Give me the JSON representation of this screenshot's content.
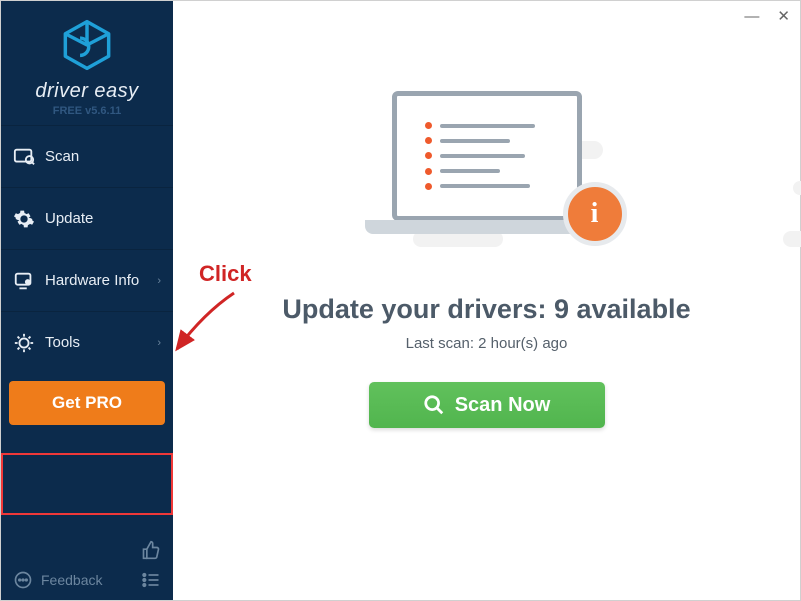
{
  "app": {
    "name": "driver easy",
    "version_line": "FREE v5.6.11"
  },
  "sidebar": {
    "items": [
      {
        "label": "Scan",
        "has_chevron": false
      },
      {
        "label": "Update",
        "has_chevron": false
      },
      {
        "label": "Hardware Info",
        "has_chevron": true
      },
      {
        "label": "Tools",
        "has_chevron": true
      }
    ],
    "getpro_label": "Get PRO",
    "feedback_label": "Feedback"
  },
  "main": {
    "headline_prefix": "Update your drivers: ",
    "headline_count": "9",
    "headline_suffix": " available",
    "subline": "Last scan: 2 hour(s) ago",
    "scan_label": "Scan Now",
    "info_badge": "i"
  },
  "window": {
    "minimize": "—",
    "close": "✕"
  },
  "annotation": {
    "text": "Click"
  }
}
